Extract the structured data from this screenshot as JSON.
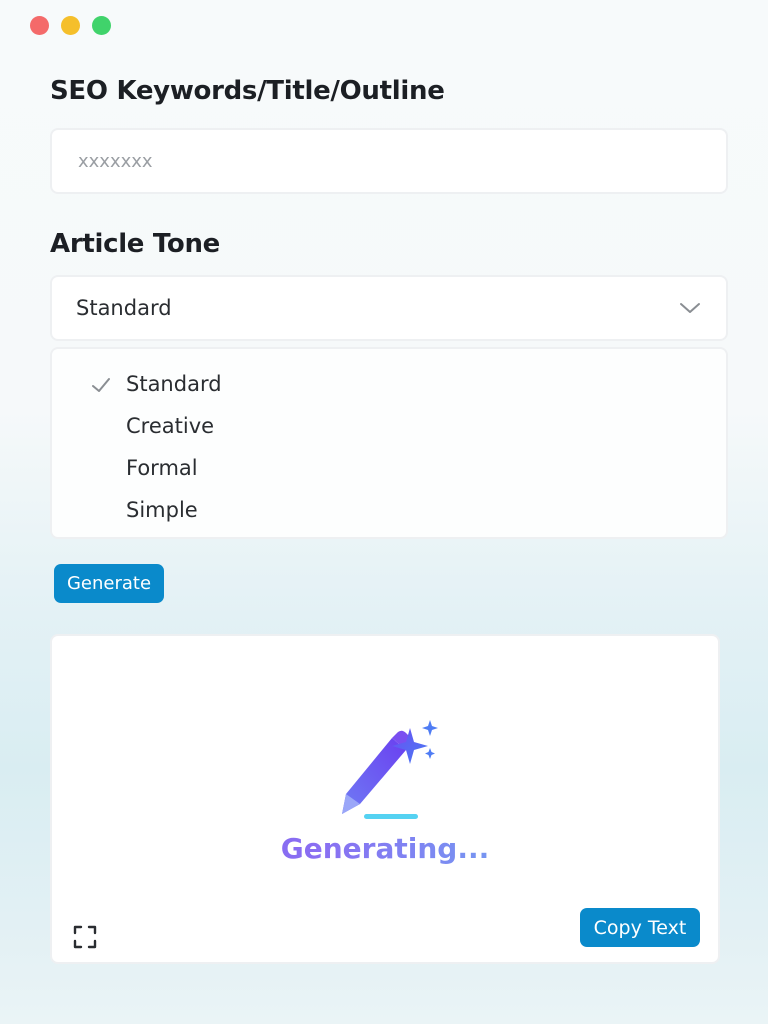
{
  "window": {
    "controls": [
      "close",
      "minimize",
      "maximize"
    ]
  },
  "seo": {
    "label": "SEO Keywords/Title/Outline",
    "placeholder": "xxxxxxx",
    "value": ""
  },
  "tone": {
    "label": "Article Tone",
    "selected": "Standard",
    "options": [
      {
        "label": "Standard",
        "checked": true
      },
      {
        "label": "Creative",
        "checked": false
      },
      {
        "label": "Formal",
        "checked": false
      },
      {
        "label": "Simple",
        "checked": false
      }
    ]
  },
  "actions": {
    "generate_label": "Generate",
    "copy_label": "Copy Text"
  },
  "output": {
    "status_text": "Generating...",
    "icon": "magic-pen-icon"
  },
  "colors": {
    "accent": "#0a8acb",
    "gradient_start": "#7d5cf0",
    "gradient_end": "#5cc9f0"
  }
}
